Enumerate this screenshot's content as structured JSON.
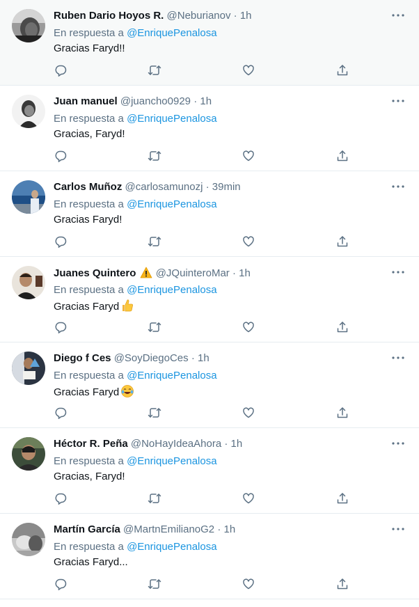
{
  "colors": {
    "text": "#0f1419",
    "secondary": "#5b7083",
    "link": "#1b95e0",
    "divider": "#e6ecf0"
  },
  "icons": {
    "more": "more-horizontal-icon",
    "reply": "reply-bubble-icon",
    "retweet": "retweet-icon",
    "like": "heart-icon",
    "share": "share-icon"
  },
  "tweets": [
    {
      "name": "Ruben Dario Hoyos R.",
      "handle": "@Neburianov",
      "sep": "·",
      "time": "1h",
      "reply_prefix": "En respuesta a",
      "mention": "@EnriquePenalosa",
      "text": "Gracias Faryd!!"
    },
    {
      "name": "Juan manuel",
      "handle": "@juancho0929",
      "sep": "·",
      "time": "1h",
      "reply_prefix": "En respuesta a",
      "mention": "@EnriquePenalosa",
      "text": "Gracias, Faryd!"
    },
    {
      "name": "Carlos Muñoz",
      "handle": "@carlosamunozj",
      "sep": "·",
      "time": "39min",
      "reply_prefix": "En respuesta a",
      "mention": "@EnriquePenalosa",
      "text": "Gracias Faryd!"
    },
    {
      "name": "Juanes Quintero",
      "handle": "@JQuinteroMar",
      "sep": "·",
      "time": "1h",
      "reply_prefix": "En respuesta a",
      "mention": "@EnriquePenalosa",
      "text": "Gracias Faryd",
      "emoji": "thumbs-up-emoji",
      "name_emoji": "warning-emoji"
    },
    {
      "name": "Diego f Ces",
      "handle": "@SoyDiegoCes",
      "sep": "·",
      "time": "1h",
      "reply_prefix": "En respuesta a",
      "mention": "@EnriquePenalosa",
      "text": "Gracias Faryd",
      "emoji": "laughing-tears-emoji"
    },
    {
      "name": "Héctor R. Peña",
      "handle": "@NoHayIdeaAhora",
      "sep": "·",
      "time": "1h",
      "reply_prefix": "En respuesta a",
      "mention": "@EnriquePenalosa",
      "text": "Gracias, Faryd!"
    },
    {
      "name": "Martín García",
      "handle": "@MartnEmilianoG2",
      "sep": "·",
      "time": "1h",
      "reply_prefix": "En respuesta a",
      "mention": "@EnriquePenalosa",
      "text": "Gracias Faryd..."
    }
  ]
}
